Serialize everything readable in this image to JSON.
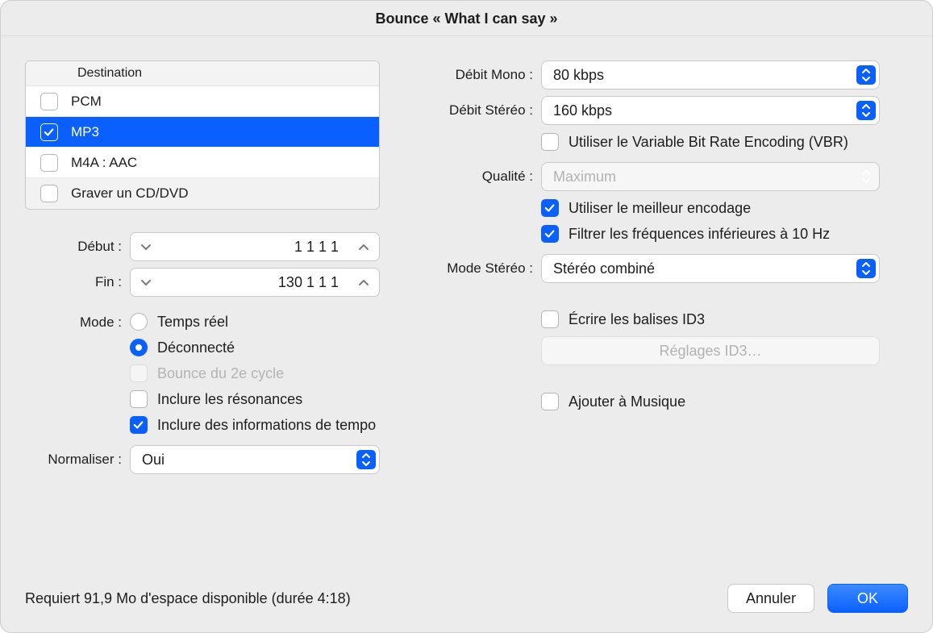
{
  "title": "Bounce « What I can say »",
  "destination": {
    "header": "Destination",
    "rows": [
      {
        "label": "PCM",
        "checked": false
      },
      {
        "label": "MP3",
        "checked": true
      },
      {
        "label": "M4A : AAC",
        "checked": false
      },
      {
        "label": "Graver un CD/DVD",
        "checked": false
      }
    ]
  },
  "left": {
    "start_label": "Début :",
    "start_value": "1  1  1      1",
    "end_label": "Fin :",
    "end_value": "130  1  1      1",
    "mode_label": "Mode :",
    "mode_options": {
      "realtime": "Temps réel",
      "offline": "Déconnecté",
      "second_cycle": "Bounce du 2e cycle",
      "include_tail": "Inclure les résonances",
      "include_tempo": "Inclure des informations de tempo"
    },
    "normalize_label": "Normaliser :",
    "normalize_value": "Oui"
  },
  "right": {
    "mono_label": "Débit Mono :",
    "mono_value": "80 kbps",
    "stereo_label": "Débit Stéréo :",
    "stereo_value": "160 kbps",
    "vbr_label": "Utiliser le Variable Bit Rate Encoding (VBR)",
    "quality_label": "Qualité :",
    "quality_value": "Maximum",
    "best_encoding": "Utiliser le meilleur encodage",
    "filter_10hz": "Filtrer les fréquences inférieures à 10 Hz",
    "stereo_mode_label": "Mode Stéréo :",
    "stereo_mode_value": "Stéréo combiné",
    "write_id3": "Écrire les balises ID3",
    "id3_settings": "Réglages ID3…",
    "add_to_music": "Ajouter à Musique"
  },
  "footer": {
    "status": "Requiert 91,9 Mo d'espace disponible (durée 4:18)",
    "cancel": "Annuler",
    "ok": "OK"
  }
}
